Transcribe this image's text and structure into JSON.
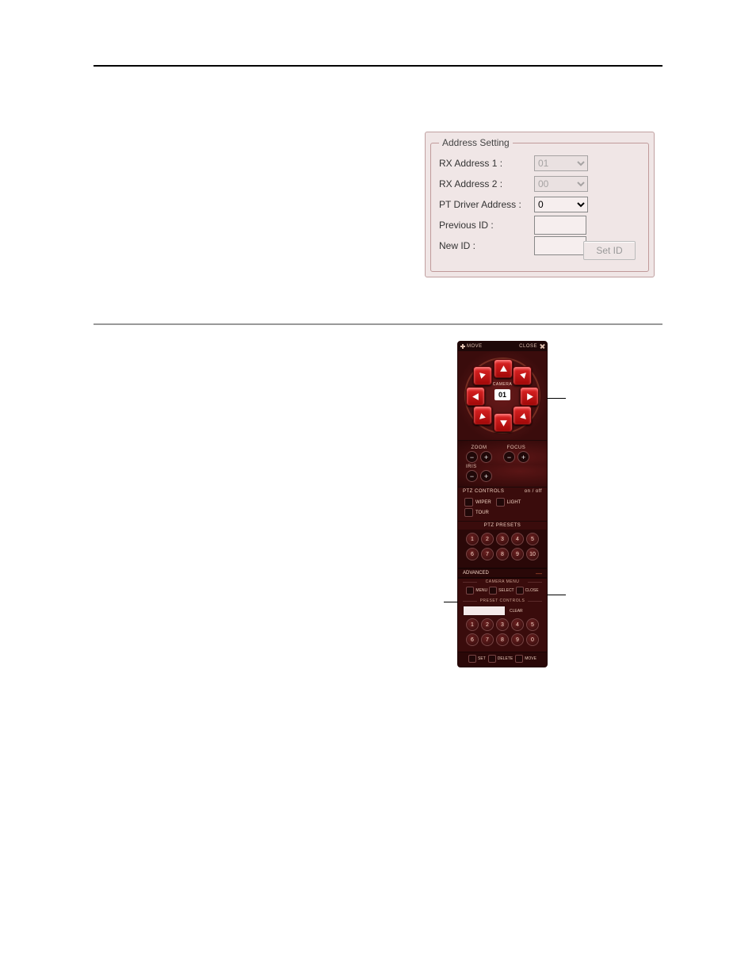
{
  "address_setting": {
    "legend": "Address Setting",
    "rx1_label": "RX Address 1 :",
    "rx1_value": "01",
    "rx2_label": "RX Address 2 :",
    "rx2_value": "00",
    "ptdrv_label": "PT Driver Address  :",
    "ptdrv_value": "0",
    "prev_label": "Previous ID :",
    "prev_value": "",
    "new_label": "New ID :",
    "new_value": "",
    "setid_label": "Set ID"
  },
  "ptz": {
    "titlebar": {
      "move": "MOVE",
      "close": "CLOSE"
    },
    "camera_label": "CAMERA",
    "camera_no": "01",
    "zoom_label": "ZOOM",
    "focus_label": "FOCUS",
    "iris_label": "IRIS",
    "minus": "−",
    "plus": "+",
    "controls_header": "PTZ CONTROLS",
    "controls_onoff": "on / off",
    "toggles": {
      "wiper": "WIPER",
      "light": "LIGHT",
      "tour": "TOUR"
    },
    "presets_header": "PTZ PRESETS",
    "presets_row1": [
      "1",
      "2",
      "3",
      "4",
      "5"
    ],
    "presets_row2": [
      "6",
      "7",
      "8",
      "9",
      "10"
    ],
    "advanced_label": "ADVANCED",
    "camera_menu_header": "CAMERA MENU",
    "menu_btns": {
      "menu": "MENU",
      "select": "SELECT",
      "close": "CLOSE"
    },
    "preset_controls_header": "PRESET CONTROLS",
    "clear_label": "CLEAR",
    "pc_row1": [
      "1",
      "2",
      "3",
      "4",
      "5"
    ],
    "pc_row2": [
      "6",
      "7",
      "8",
      "9",
      "0"
    ],
    "footer_btns": {
      "set": "SET",
      "delete": "DELETE",
      "move": "MOVE"
    }
  }
}
